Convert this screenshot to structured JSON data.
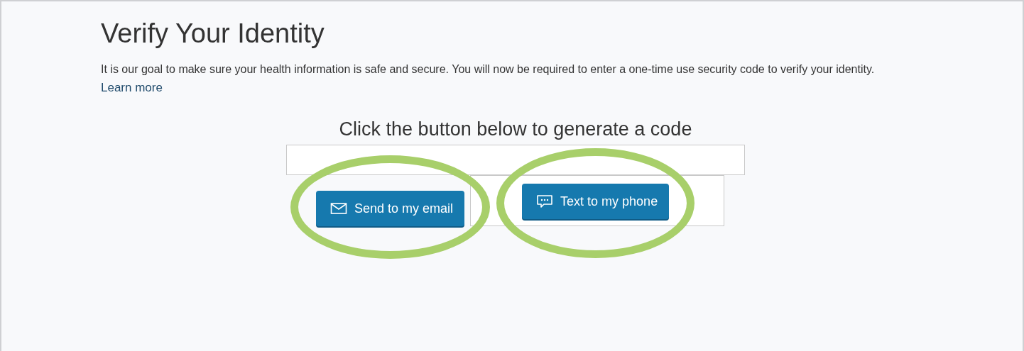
{
  "title": "Verify Your Identity",
  "intro": "It is our goal to make sure your health information is safe and secure. You will now be required to enter a one-time use security code to verify your identity.",
  "learn_more": "Learn more",
  "prompt": "Click the button below to generate a code",
  "buttons": [
    {
      "kind": "email",
      "label": "Send to my email",
      "highlighted": true
    },
    {
      "kind": "sms",
      "label": "Text to my phone",
      "highlighted": true
    }
  ]
}
